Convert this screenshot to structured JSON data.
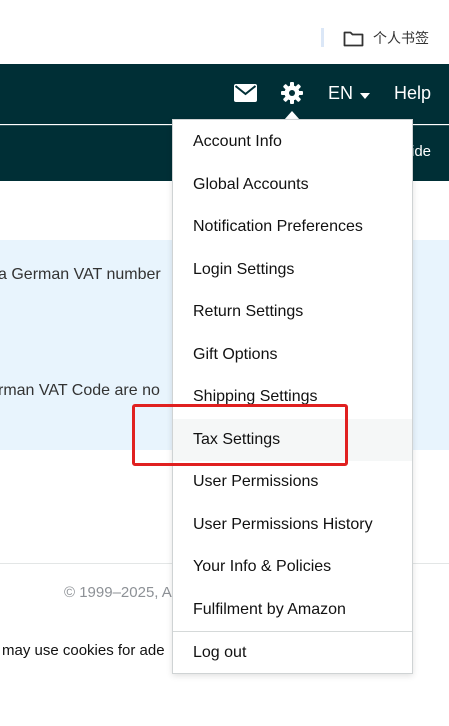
{
  "browser": {
    "bookmark_folder_label": "个人书签",
    "icon": "folder-icon"
  },
  "nav": {
    "mail_icon": "mail-icon",
    "settings_icon": "gear-icon",
    "language": "EN",
    "help": "Help",
    "sub_right_text": "ide"
  },
  "page": {
    "info_line1": "a German VAT number",
    "info_line2": "rman VAT Code are no",
    "copyright": "© 1999–2025, A",
    "cookie_text": "may use cookies for ade"
  },
  "settings_menu": {
    "items": [
      {
        "label": "Account Info"
      },
      {
        "label": "Global Accounts"
      },
      {
        "label": "Notification Preferences"
      },
      {
        "label": "Login Settings"
      },
      {
        "label": "Return Settings"
      },
      {
        "label": "Gift Options"
      },
      {
        "label": "Shipping Settings"
      },
      {
        "label": "Tax Settings"
      },
      {
        "label": "User Permissions"
      },
      {
        "label": "User Permissions History"
      },
      {
        "label": "Your Info & Policies"
      },
      {
        "label": "Fulfilment by Amazon"
      },
      {
        "label": "Log out"
      }
    ],
    "highlighted_item": "Tax Settings"
  },
  "colors": {
    "nav_background": "#002f36",
    "info_panel": "#e8f4fd",
    "highlight_border": "#e02020"
  }
}
